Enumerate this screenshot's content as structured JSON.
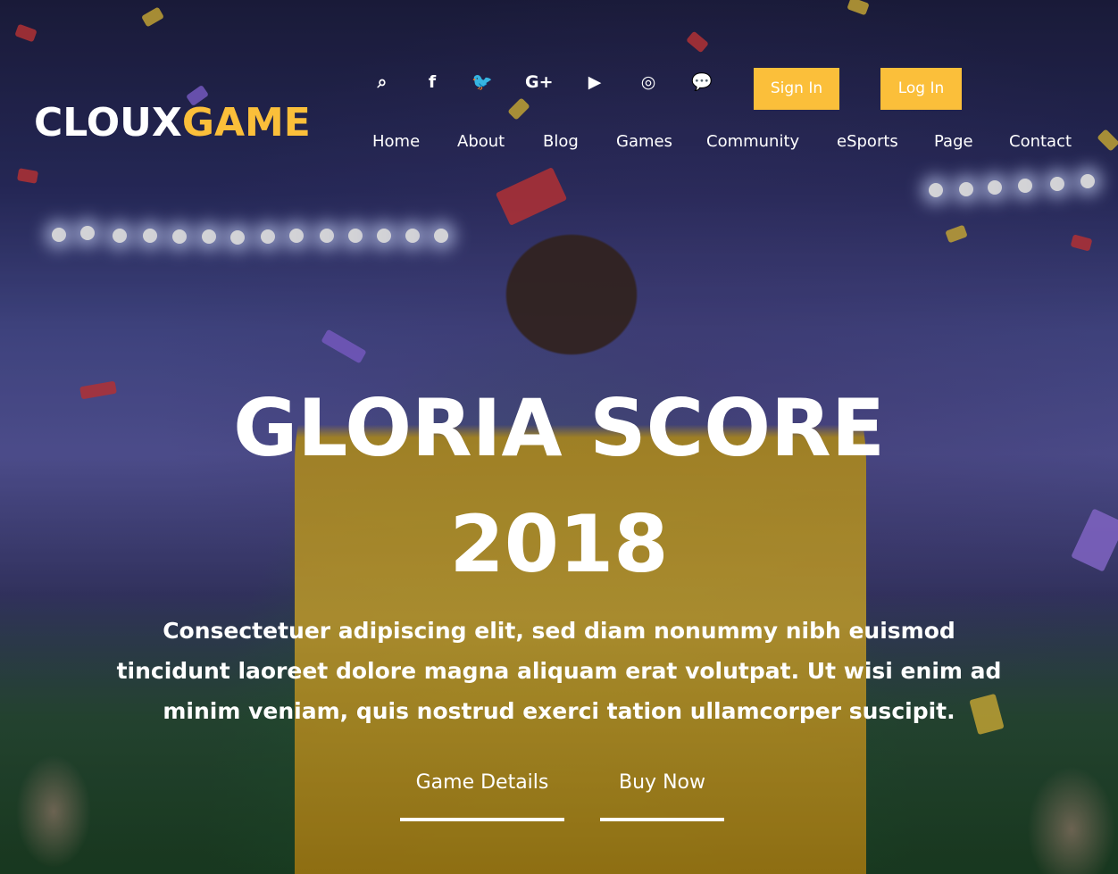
{
  "brand": {
    "logo_white": "CLOUX",
    "logo_yellow": "GAME"
  },
  "colors": {
    "accent": "#fbbf3a",
    "text": "#ffffff"
  },
  "header": {
    "social_icons": [
      {
        "name": "search-icon",
        "glyph": "⌕"
      },
      {
        "name": "facebook-icon",
        "glyph": "f"
      },
      {
        "name": "twitter-icon",
        "glyph": "🐦"
      },
      {
        "name": "google-plus-icon",
        "glyph": "G+"
      },
      {
        "name": "youtube-icon",
        "glyph": "▶"
      },
      {
        "name": "instagram-icon",
        "glyph": "◎"
      },
      {
        "name": "chat-icon",
        "glyph": "💬"
      }
    ],
    "sign_in_label": "Sign In",
    "log_in_label": "Log In"
  },
  "nav": {
    "items": [
      "Home",
      "About",
      "Blog",
      "Games",
      "Community",
      "eSports",
      "Page",
      "Contact"
    ]
  },
  "hero": {
    "title_line1": "GLORIA SCORE",
    "title_line2": "2018",
    "description": "Consectetuer adipiscing elit, sed diam nonummy nibh euismod tincidunt laoreet dolore magna aliquam erat volutpat. Ut wisi enim ad minim veniam, quis nostrud exerci tation ullamcorper suscipit.",
    "game_details_label": "Game Details",
    "buy_now_label": "Buy Now"
  }
}
